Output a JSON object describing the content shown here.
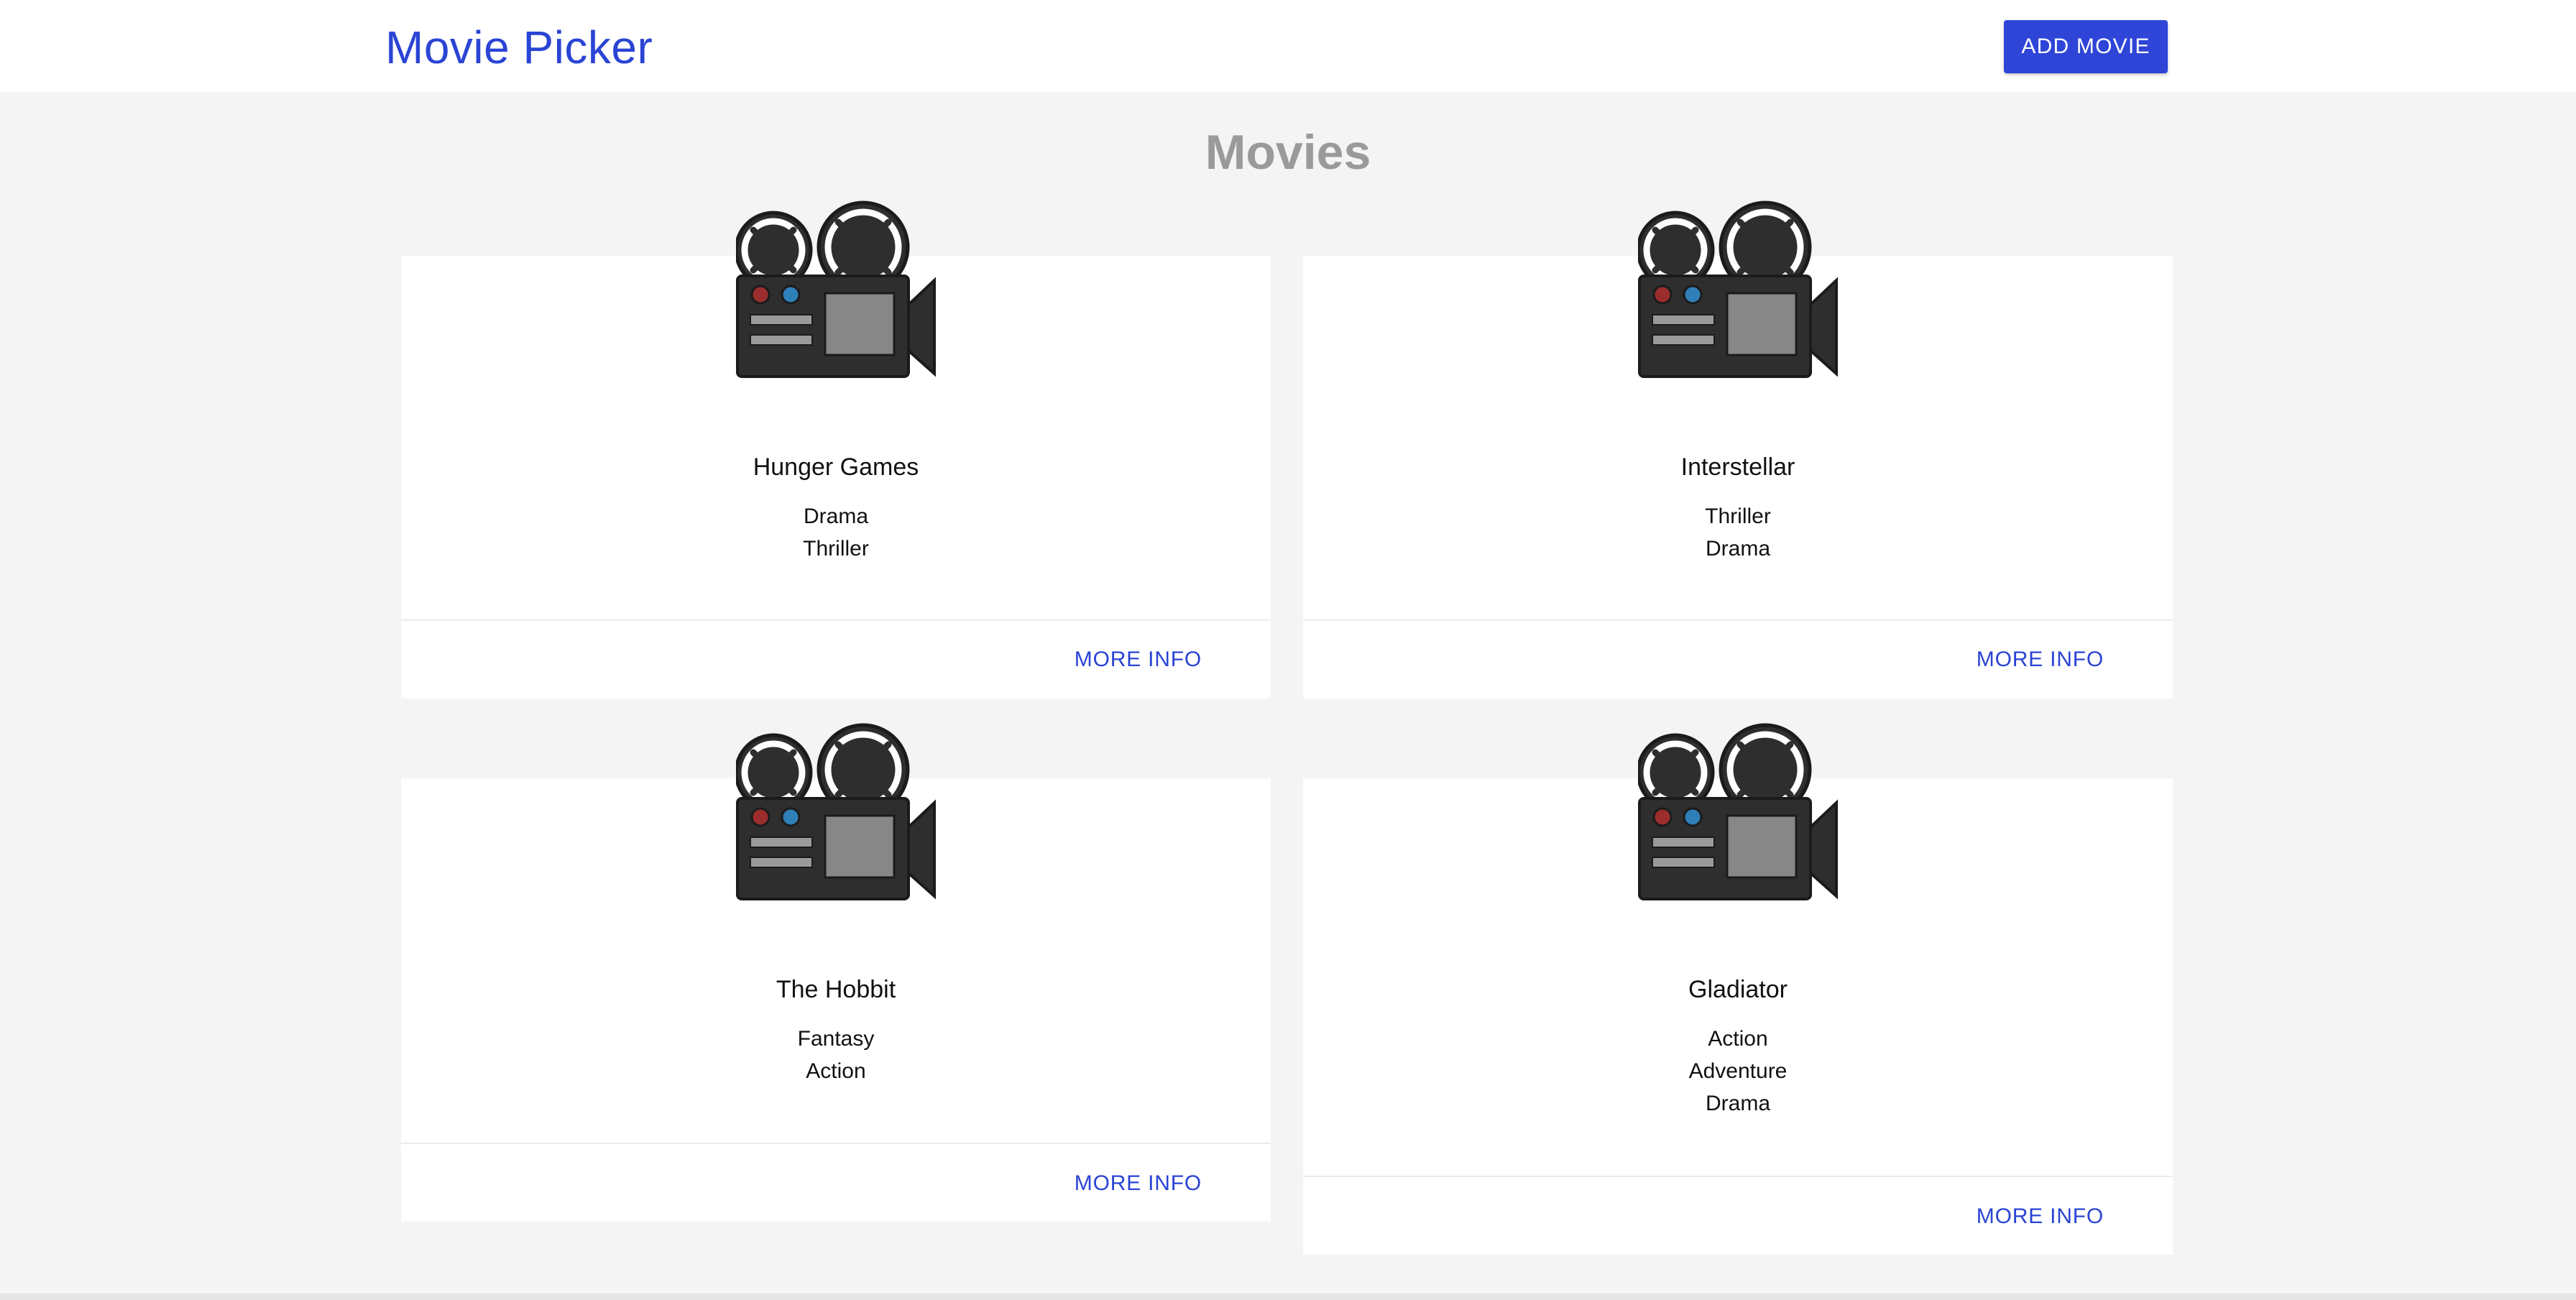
{
  "header": {
    "brand": "Movie Picker",
    "add_button": "ADD MOVIE"
  },
  "page": {
    "title": "Movies"
  },
  "movies": [
    {
      "title": "Hunger Games",
      "genres": [
        "Drama",
        "Thriller"
      ],
      "action": "MORE INFO",
      "icon": "film-projector-icon"
    },
    {
      "title": "Interstellar",
      "genres": [
        "Thriller",
        "Drama"
      ],
      "action": "MORE INFO",
      "icon": "film-projector-icon"
    },
    {
      "title": "The Hobbit",
      "genres": [
        "Fantasy",
        "Action"
      ],
      "action": "MORE INFO",
      "icon": "film-projector-icon"
    },
    {
      "title": "Gladiator",
      "genres": [
        "Action",
        "Adventure",
        "Drama"
      ],
      "action": "MORE INFO",
      "icon": "film-projector-icon"
    }
  ],
  "colors": {
    "brand": "#2a44d4",
    "button": "#2e45d8",
    "background": "#f4f4f4",
    "card": "#ffffff",
    "muted_title": "#9a9a9a"
  }
}
